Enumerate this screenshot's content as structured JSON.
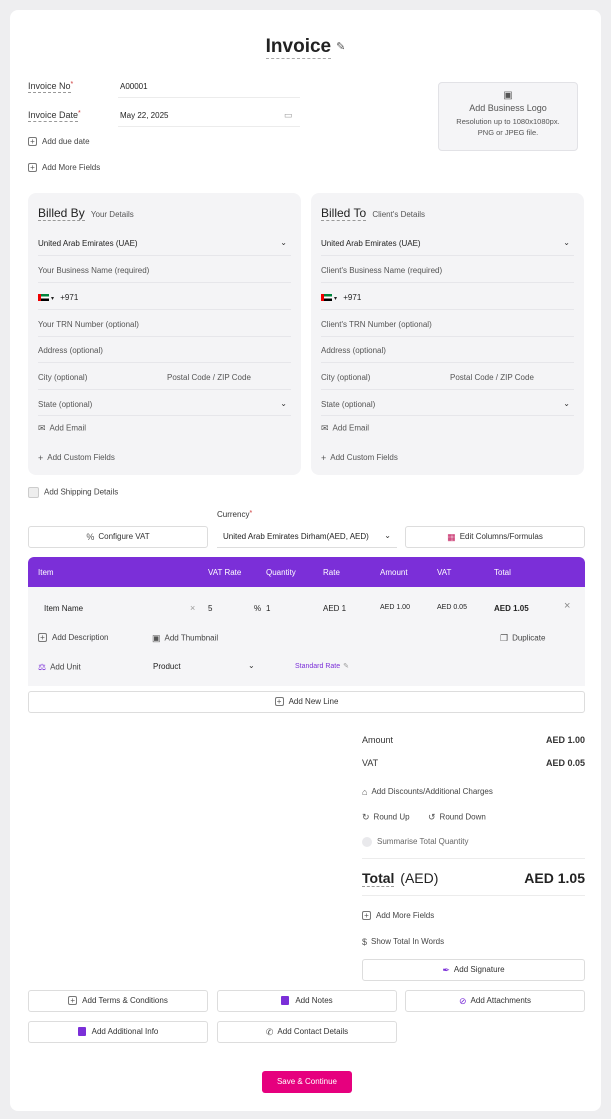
{
  "header": {
    "title": "Invoice"
  },
  "meta": {
    "invoice_no_label": "Invoice No",
    "invoice_no_value": "A00001",
    "invoice_date_label": "Invoice Date",
    "invoice_date_value": "May 22, 2025",
    "required_mark": "*",
    "add_due_date": "Add due date",
    "add_more_fields": "Add More Fields"
  },
  "logo": {
    "title": "Add Business Logo",
    "line1": "Resolution up to 1080x1080px.",
    "line2": "PNG or JPEG file."
  },
  "billed_by": {
    "title": "Billed By",
    "subtitle": "Your Details",
    "country": "United Arab Emirates (UAE)",
    "business_name": "Your Business Name (required)",
    "phone_code": "+971",
    "trn": "Your TRN Number (optional)",
    "address": "Address (optional)",
    "city": "City (optional)",
    "postal": "Postal Code / ZIP Code",
    "state": "State (optional)",
    "add_email": "Add Email",
    "add_custom": "Add Custom Fields"
  },
  "billed_to": {
    "title": "Billed To",
    "subtitle": "Client's Details",
    "country": "United Arab Emirates (UAE)",
    "business_name": "Client's Business Name (required)",
    "phone_code": "+971",
    "trn": "Client's TRN Number (optional)",
    "address": "Address (optional)",
    "city": "City (optional)",
    "postal": "Postal Code / ZIP Code",
    "state": "State (optional)",
    "add_email": "Add Email",
    "add_custom": "Add Custom Fields"
  },
  "shipping": {
    "label": "Add Shipping Details"
  },
  "currency": {
    "label": "Currency",
    "value": "United Arab Emirates Dirham(AED, AED)",
    "configure_vat": "Configure VAT",
    "edit_columns": "Edit Columns/Formulas"
  },
  "table": {
    "headers": [
      "Item",
      "VAT Rate",
      "Quantity",
      "Rate",
      "Amount",
      "VAT",
      "Total"
    ],
    "item_name": "Item Name",
    "vat_rate": "5",
    "percent": "%",
    "quantity": "1",
    "rate": "AED 1",
    "amount": "AED 1.00",
    "vat": "AED 0.05",
    "total": "AED 1.05",
    "add_description": "Add Description",
    "add_thumbnail": "Add Thumbnail",
    "duplicate": "Duplicate",
    "add_unit": "Add Unit",
    "unit_type": "Product",
    "standard_rate": "Standard Rate",
    "add_new_line": "Add New Line"
  },
  "totals": {
    "amount_label": "Amount",
    "amount_value": "AED 1.00",
    "vat_label": "VAT",
    "vat_value": "AED 0.05",
    "discounts": "Add Discounts/Additional Charges",
    "round_up": "Round Up",
    "round_down": "Round Down",
    "summarise": "Summarise Total Quantity",
    "total_label": "Total",
    "total_currency": "(AED)",
    "total_value": "AED 1.05",
    "add_more_fields": "Add More Fields",
    "show_words": "Show Total In Words",
    "add_signature": "Add Signature"
  },
  "extras": {
    "terms": "Add Terms & Conditions",
    "notes": "Add Notes",
    "attachments": "Add Attachments",
    "additional_info": "Add Additional Info",
    "contact": "Add Contact Details"
  },
  "actions": {
    "save": "Save & Continue"
  },
  "colors": {
    "accent": "#7b2fd8",
    "primary_button": "#e6007e"
  }
}
